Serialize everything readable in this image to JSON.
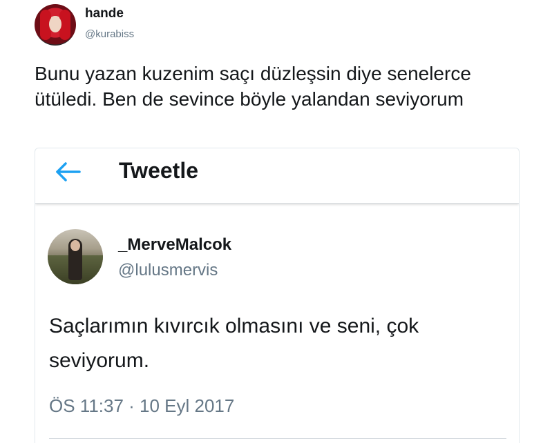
{
  "outer_tweet": {
    "display_name": "hande",
    "handle": "@kurabiss",
    "text": "Bunu yazan kuzenim saçı düzleşsin diye senelerce ütüledi. Ben de sevince böyle yalandan seviyorum"
  },
  "embedded_screenshot": {
    "back_icon": "arrow-left-icon",
    "title": "Tweetle",
    "tweet": {
      "display_name": "_MerveMalcok",
      "handle": "@lulusmervis",
      "text": "Saçlarımın kıvırcık olmasını ve seni, çok seviyorum.",
      "timestamp": "ÖS 11:37 · 10 Eyl 2017"
    }
  },
  "colors": {
    "accent": "#1da1f2",
    "secondary_text": "#657786",
    "primary_text": "#14171a"
  }
}
